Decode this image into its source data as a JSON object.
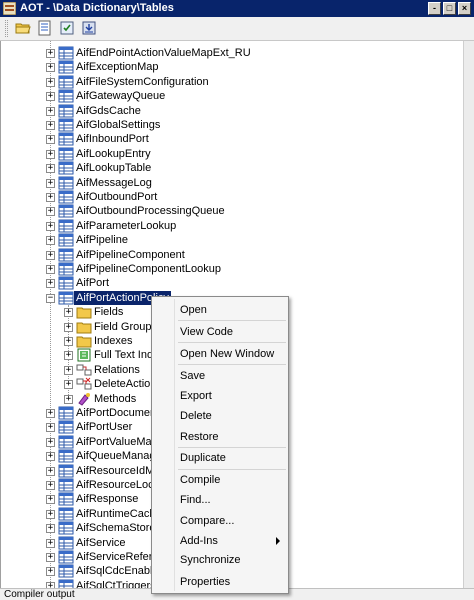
{
  "window": {
    "title": "AOT - \\Data Dictionary\\Tables",
    "minimize_glyph": "-",
    "restore_glyph": "□",
    "close_glyph": "×"
  },
  "toolbar": {
    "buttons": [
      "open-folder-icon",
      "properties-icon",
      "compile-icon",
      "save-icon"
    ]
  },
  "tree": {
    "items_before": [
      "AifEndPointActionValueMapExt_RU",
      "AifExceptionMap",
      "AifFileSystemConfiguration",
      "AifGatewayQueue",
      "AifGdsCache",
      "AifGlobalSettings",
      "AifInboundPort",
      "AifLookupEntry",
      "AifLookupTable",
      "AifMessageLog",
      "AifOutboundPort",
      "AifOutboundProcessingQueue",
      "AifParameterLookup",
      "AifPipeline",
      "AifPipelineComponent",
      "AifPipelineComponentLookup",
      "AifPort"
    ],
    "selected": "AifPortActionPolicy",
    "children": [
      {
        "label": "Fields",
        "icon": "fields-folder-icon"
      },
      {
        "label": "Field Groups",
        "icon": "field-groups-folder-icon"
      },
      {
        "label": "Indexes",
        "icon": "indexes-folder-icon"
      },
      {
        "label": "Full Text Index",
        "icon": "full-text-index-icon"
      },
      {
        "label": "Relations",
        "icon": "relations-icon"
      },
      {
        "label": "DeleteActions",
        "icon": "delete-actions-icon"
      },
      {
        "label": "Methods",
        "icon": "methods-icon"
      }
    ],
    "items_after": [
      "AifPortDocument",
      "AifPortUser",
      "AifPortValueMap",
      "AifQueueManager",
      "AifResourceIdMap",
      "AifResourceLock",
      "AifResponse",
      "AifRuntimeCache",
      "AifSchemaStore",
      "AifService",
      "AifServiceReferenc",
      "AifSqlCdcEnabledT",
      "AifSqlCtTriggers"
    ]
  },
  "context_menu": {
    "items": [
      "Open",
      "View Code",
      "Open New Window",
      "Save",
      "Export",
      "Delete",
      "Restore",
      "Duplicate",
      "Compile",
      "Find...",
      "Compare...",
      "Add-Ins",
      "Synchronize",
      "Properties"
    ],
    "submenu_items": [
      "Add-Ins"
    ]
  },
  "status_bar": {
    "text": "Compiler output"
  },
  "colors": {
    "titlebar": "#08246b",
    "selection": "#0a246a",
    "table_icon_blue": "#3a6cc8"
  }
}
